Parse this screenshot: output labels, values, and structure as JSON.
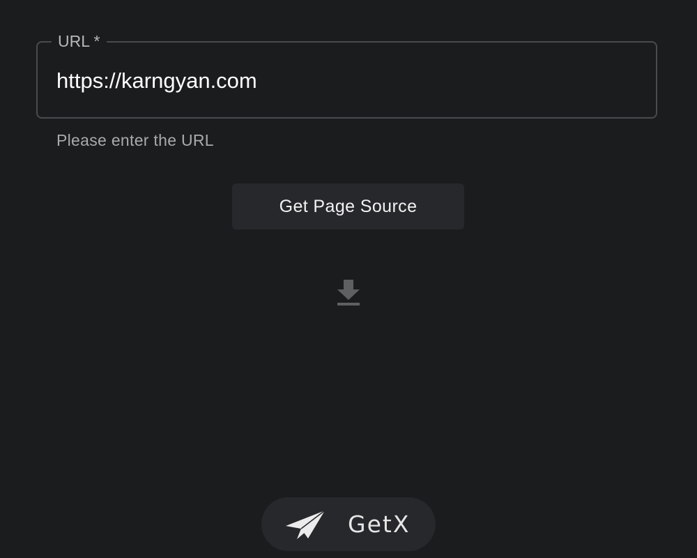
{
  "url_field": {
    "label": "URL *",
    "value": "https://karngyan.com",
    "helper_text": "Please enter the URL"
  },
  "actions": {
    "get_source_label": "Get Page Source",
    "download_icon": "download-icon"
  },
  "brand": {
    "logo_icon": "paper-plane-icon",
    "name": "GetX"
  },
  "colors": {
    "background": "#1b1c1e",
    "surface": "#27282b",
    "outline": "#4a4b4e",
    "icon": "#5f6062"
  }
}
